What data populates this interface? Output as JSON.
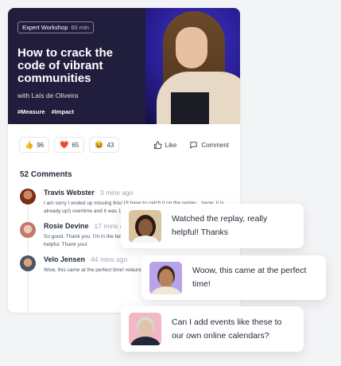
{
  "hero": {
    "tag_label": "Expert Workshop",
    "tag_duration": "60 min",
    "title": "How to crack the code of vibrant communities",
    "subtitle": "with Laís de Oliveira",
    "hashtags": [
      "#Measure",
      "#Impact"
    ]
  },
  "reactions": [
    {
      "icon": "thumbs-up-icon",
      "emoji": "👍",
      "count": "96"
    },
    {
      "icon": "heart-icon",
      "emoji": "❤️",
      "count": "65"
    },
    {
      "icon": "laughing-icon",
      "emoji": "😆",
      "count": "43"
    }
  ],
  "actions": {
    "like": "Like",
    "comment": "Comment"
  },
  "comments_title": "52 Comments",
  "comments": [
    {
      "name": "Travis Webster",
      "time": "3 mins ago",
      "text": "I am sorry I ended up missing this! I'll have to catch it on the replay... (wow, it is already up!) overtime and it was 12:30 by th",
      "avatar_color": "#7c2d12"
    },
    {
      "name": "Rosie Devine",
      "time": "17 mins ag",
      "text": "So good. Thank you. I'm in the beginning stages of my community — this was very helpful. Thank you!",
      "avatar_color": "#be7b6b"
    },
    {
      "name": "Velo Jensen",
      "time": "44 mins ago",
      "text": "Wow, this came at the perfect time! relaunching our community soon",
      "avatar_color": "#4b5563"
    }
  ],
  "bubbles": [
    {
      "text": "Watched the replay, really helpful! Thanks",
      "avatar_bg": "#d9c3a0",
      "face": "#8a5a3c"
    },
    {
      "text": "Woow, this came at the perfect time!",
      "avatar_bg": "#b9a3e8",
      "face": "#b8825c"
    },
    {
      "text": "Can I add events like these to our own online calendars?",
      "avatar_bg": "#f2b8c6",
      "face": "#e2c2a9"
    }
  ],
  "colors": {
    "hero_bg": "#211d3c",
    "accent": "#2a1e94"
  }
}
